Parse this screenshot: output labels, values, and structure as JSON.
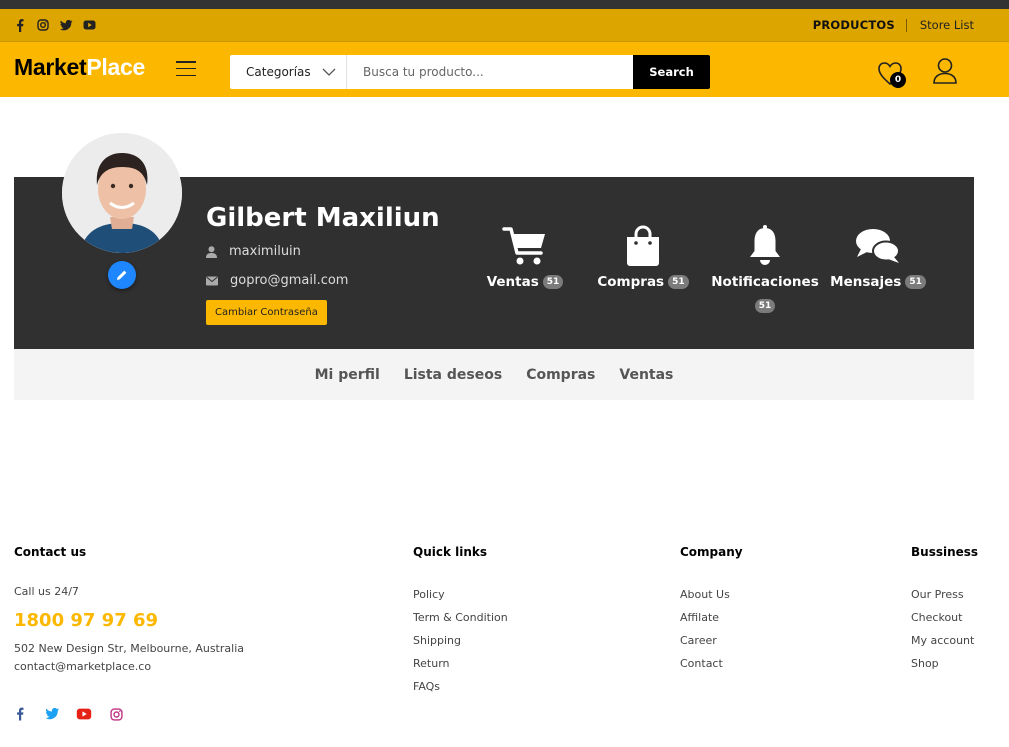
{
  "topbar": {
    "social_icons": [
      "facebook-icon",
      "instagram-icon",
      "twitter-icon",
      "youtube-icon"
    ],
    "productos_label": "PRODUCTOS",
    "store_label": "Store List"
  },
  "header": {
    "logo_main": "Market",
    "logo_accent": "Place",
    "category_label": "Categorías",
    "search_placeholder": "Busca tu producto...",
    "search_button": "Search",
    "wishlist_count": "0"
  },
  "profile": {
    "name": "Gilbert Maxiliun",
    "username": "maximiluin",
    "email": "gopro@gmail.com",
    "change_password": "Cambiar Contraseña",
    "stats": [
      {
        "label": "Ventas",
        "count": "51",
        "icon": "cart-icon"
      },
      {
        "label": "Compras",
        "count": "51",
        "icon": "shopping-bag-icon"
      },
      {
        "label": "Notificaciones",
        "count": "51",
        "icon": "bell-icon"
      },
      {
        "label": "Mensajes",
        "count": "51",
        "icon": "chat-icon"
      }
    ]
  },
  "tabs": [
    "Mi perfil",
    "Lista deseos",
    "Compras",
    "Ventas"
  ],
  "footer": {
    "contact": {
      "title": "Contact us",
      "call_label": "Call us 24/7",
      "phone": "1800 97 97 69",
      "address": "502 New Design Str, Melbourne, Australia",
      "email": "contact@marketplace.co"
    },
    "quick_links": {
      "title": "Quick links",
      "items": [
        "Policy",
        "Term & Condition",
        "Shipping",
        "Return",
        "FAQs"
      ]
    },
    "company": {
      "title": "Company",
      "items": [
        "About Us",
        "Affilate",
        "Career",
        "Contact"
      ]
    },
    "business": {
      "title": "Bussiness",
      "items": [
        "Our Press",
        "Checkout",
        "My account",
        "Shop"
      ]
    },
    "social_icons": [
      "facebook-icon",
      "twitter-icon",
      "youtube-icon",
      "instagram-icon"
    ]
  },
  "colors": {
    "accent": "#fcb800",
    "topbar": "#dca500",
    "panel": "#303030",
    "edit_button": "#1e87ff"
  }
}
